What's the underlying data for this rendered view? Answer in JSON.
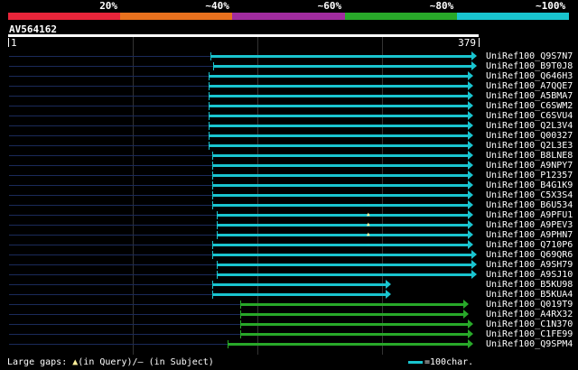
{
  "scale": {
    "labels": [
      "20%",
      "~40%",
      "~60%",
      "~80%",
      "~100%"
    ],
    "colors": [
      "#e8253a",
      "#e8711e",
      "#a12c9f",
      "#28a829",
      "#19c4cf"
    ]
  },
  "query": {
    "id": "AV564162",
    "start": "1",
    "end": "379",
    "length": 379
  },
  "hits": [
    {
      "name": "UniRef100_Q9S7N7",
      "start": 166,
      "end": 379,
      "color": "#19c4cf"
    },
    {
      "name": "UniRef100_B9T0J8",
      "start": 168,
      "end": 379,
      "color": "#19c4cf"
    },
    {
      "name": "UniRef100_Q646H3",
      "start": 164,
      "end": 376,
      "color": "#19c4cf"
    },
    {
      "name": "UniRef100_A7QQE7",
      "start": 164,
      "end": 376,
      "color": "#19c4cf"
    },
    {
      "name": "UniRef100_A5BMA7",
      "start": 164,
      "end": 376,
      "color": "#19c4cf"
    },
    {
      "name": "UniRef100_C6SWM2",
      "start": 164,
      "end": 376,
      "color": "#19c4cf"
    },
    {
      "name": "UniRef100_C6SVU4",
      "start": 164,
      "end": 376,
      "color": "#19c4cf"
    },
    {
      "name": "UniRef100_Q2L3V4",
      "start": 164,
      "end": 376,
      "color": "#19c4cf"
    },
    {
      "name": "UniRef100_Q00327",
      "start": 164,
      "end": 376,
      "color": "#19c4cf"
    },
    {
      "name": "UniRef100_Q2L3E3",
      "start": 164,
      "end": 376,
      "color": "#19c4cf"
    },
    {
      "name": "UniRef100_B8LNE8",
      "start": 167,
      "end": 376,
      "color": "#19c4cf"
    },
    {
      "name": "UniRef100_A9NPY7",
      "start": 167,
      "end": 376,
      "color": "#19c4cf"
    },
    {
      "name": "UniRef100_P12357",
      "start": 167,
      "end": 376,
      "color": "#19c4cf"
    },
    {
      "name": "UniRef100_B4G1K9",
      "start": 167,
      "end": 376,
      "color": "#19c4cf"
    },
    {
      "name": "UniRef100_C5X3S4",
      "start": 167,
      "end": 376,
      "color": "#19c4cf"
    },
    {
      "name": "UniRef100_B6U534",
      "start": 167,
      "end": 376,
      "color": "#19c4cf"
    },
    {
      "name": "UniRef100_A9PFU1",
      "start": 171,
      "end": 376,
      "color": "#19c4cf",
      "gap": "▲"
    },
    {
      "name": "UniRef100_A9PEV3",
      "start": 171,
      "end": 376,
      "color": "#19c4cf",
      "gap": "▲"
    },
    {
      "name": "UniRef100_A9PHN7",
      "start": 171,
      "end": 376,
      "color": "#19c4cf",
      "gap": "▲"
    },
    {
      "name": "UniRef100_Q710P6",
      "start": 167,
      "end": 376,
      "color": "#19c4cf"
    },
    {
      "name": "UniRef100_Q69QR6",
      "start": 167,
      "end": 379,
      "color": "#19c4cf"
    },
    {
      "name": "UniRef100_A9SH79",
      "start": 171,
      "end": 379,
      "color": "#19c4cf"
    },
    {
      "name": "UniRef100_A9SJ10",
      "start": 171,
      "end": 379,
      "color": "#19c4cf"
    },
    {
      "name": "UniRef100_B5KU98",
      "start": 167,
      "end": 309,
      "color": "#19c4cf"
    },
    {
      "name": "UniRef100_B5KUA4",
      "start": 167,
      "end": 309,
      "color": "#19c4cf"
    },
    {
      "name": "UniRef100_Q019T9",
      "start": 190,
      "end": 372,
      "color": "#28a829"
    },
    {
      "name": "UniRef100_A4RX32",
      "start": 190,
      "end": 372,
      "color": "#28a829"
    },
    {
      "name": "UniRef100_C1N370",
      "start": 190,
      "end": 376,
      "color": "#28a829"
    },
    {
      "name": "UniRef100_C1FE99",
      "start": 190,
      "end": 376,
      "color": "#28a829"
    },
    {
      "name": "UniRef100_Q9SPM4",
      "start": 180,
      "end": 376,
      "color": "#28a829"
    }
  ],
  "legend": {
    "gaps_prefix": "Large gaps: ",
    "gaps_query_symbol": "▲",
    "gaps_query_text": "(in Query)/",
    "gaps_subject_symbol": "–",
    "gaps_subject_text": " (in Subject)",
    "scale_text": "=100char."
  }
}
